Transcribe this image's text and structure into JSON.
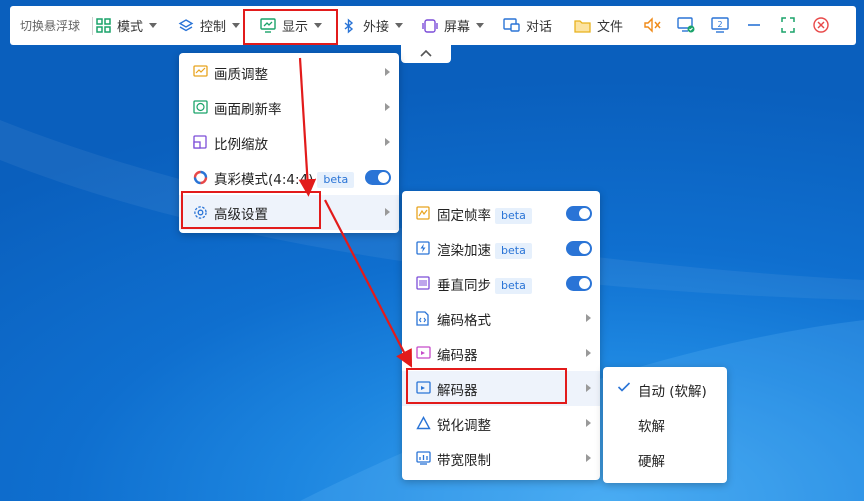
{
  "toolbar": {
    "float_label": "切换悬浮球",
    "mode": "模式",
    "control": "控制",
    "display": "显示",
    "peripheral": "外接",
    "screen": "屏幕",
    "chat": "对话",
    "file": "文件"
  },
  "display_menu": {
    "items": [
      {
        "label": "画质调整"
      },
      {
        "label": "画面刷新率"
      },
      {
        "label": "比例缩放"
      },
      {
        "label": "真彩模式(4:4:4)",
        "badge": "beta",
        "toggle": true
      },
      {
        "label": "高级设置"
      }
    ]
  },
  "advanced_menu": {
    "items": [
      {
        "label": "固定帧率",
        "badge": "beta"
      },
      {
        "label": "渲染加速",
        "badge": "beta"
      },
      {
        "label": "垂直同步",
        "badge": "beta"
      },
      {
        "label": "编码格式"
      },
      {
        "label": "编码器"
      },
      {
        "label": "解码器"
      },
      {
        "label": "锐化调整"
      },
      {
        "label": "带宽限制"
      }
    ]
  },
  "decoder_menu": {
    "items": [
      {
        "label": "自动 (软解)",
        "selected": true
      },
      {
        "label": "软解"
      },
      {
        "label": "硬解"
      }
    ]
  },
  "colors": {
    "accent": "#2a74d6",
    "annotation_red": "#e21b1b",
    "green_icon": "#1aa36a"
  }
}
